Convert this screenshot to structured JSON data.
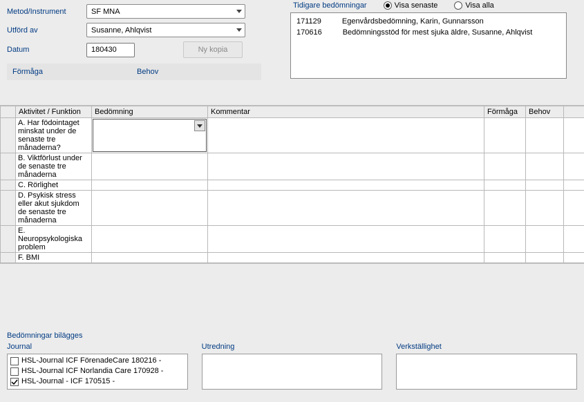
{
  "form": {
    "metod_label": "Metod/Instrument",
    "metod_value": "SF MNA",
    "utford_label": "Utförd av",
    "utford_value": "Susanne, Ahlqvist",
    "datum_label": "Datum",
    "datum_value": "180430",
    "ny_kopia": "Ny kopia",
    "formaga": "Förmåga",
    "behov": "Behov"
  },
  "prev": {
    "title": "Tidigare bedömningar",
    "radio_latest": "Visa senaste",
    "radio_all": "Visa alla",
    "rows": [
      {
        "date": "171129",
        "text": "Egenvårdsbedömning, Karin, Gunnarsson"
      },
      {
        "date": "170616",
        "text": "Bedömningsstöd för mest sjuka äldre, Susanne, Ahlqvist"
      }
    ]
  },
  "grid": {
    "headers": {
      "aktivitet": "Aktivitet / Funktion",
      "bedomning": "Bedömning",
      "kommentar": "Kommentar",
      "formaga": "Förmåga",
      "behov": "Behov"
    },
    "rows": [
      "A. Har födointaget minskat under de senaste tre månaderna?",
      "B. Viktförlust under de senaste tre månaderna",
      "C. Rörlighet",
      "D. Psykisk stress eller akut sjukdom de senaste tre månaderna",
      "E. Neuropsykologiska problem",
      "F. BMI"
    ]
  },
  "bottom": {
    "title": "Bedömningar bilägges",
    "journal": "Journal",
    "utredning": "Utredning",
    "verkstallighet": "Verkställighet",
    "items": [
      {
        "label": "HSL-Journal ICF FörenadeCare 180216 -",
        "checked": false
      },
      {
        "label": "HSL-Journal ICF Norlandia Care 170928 -",
        "checked": false
      },
      {
        "label": "HSL-Journal - ICF 170515 -",
        "checked": true
      }
    ]
  }
}
